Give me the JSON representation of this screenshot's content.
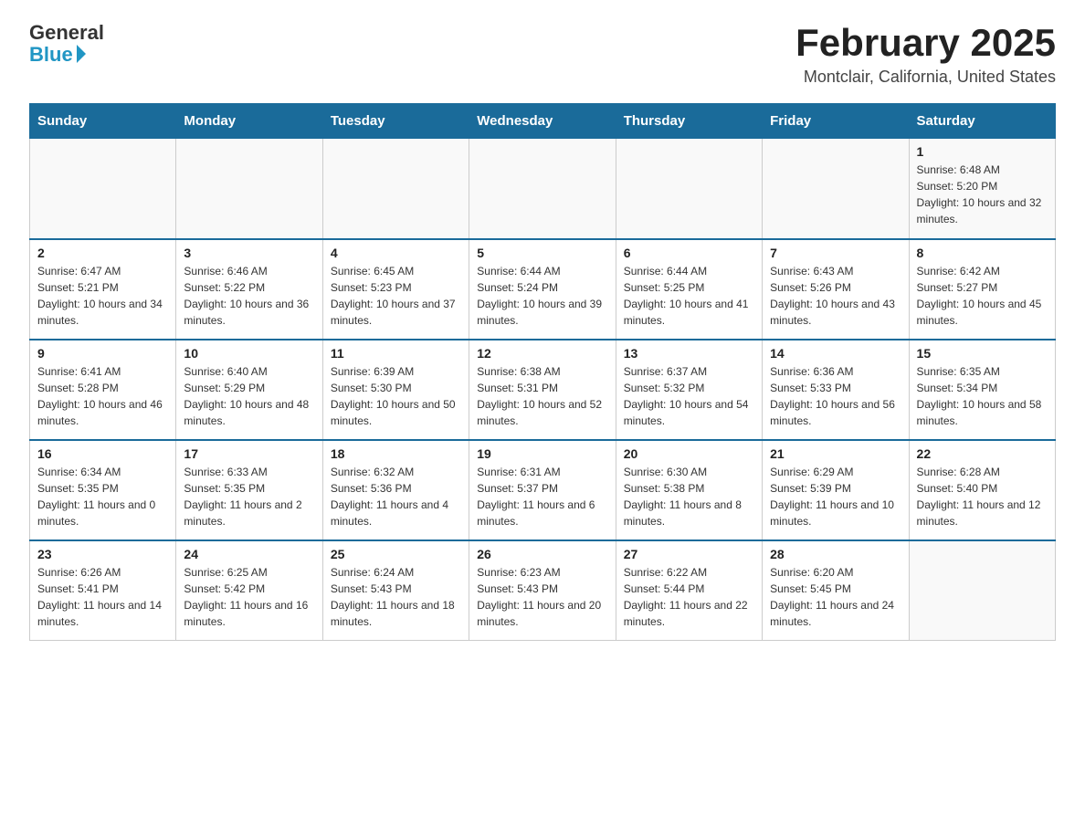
{
  "logo": {
    "general": "General",
    "blue": "Blue"
  },
  "header": {
    "title": "February 2025",
    "subtitle": "Montclair, California, United States"
  },
  "weekdays": [
    "Sunday",
    "Monday",
    "Tuesday",
    "Wednesday",
    "Thursday",
    "Friday",
    "Saturday"
  ],
  "weeks": [
    [
      {
        "day": "",
        "sunrise": "",
        "sunset": "",
        "daylight": ""
      },
      {
        "day": "",
        "sunrise": "",
        "sunset": "",
        "daylight": ""
      },
      {
        "day": "",
        "sunrise": "",
        "sunset": "",
        "daylight": ""
      },
      {
        "day": "",
        "sunrise": "",
        "sunset": "",
        "daylight": ""
      },
      {
        "day": "",
        "sunrise": "",
        "sunset": "",
        "daylight": ""
      },
      {
        "day": "",
        "sunrise": "",
        "sunset": "",
        "daylight": ""
      },
      {
        "day": "1",
        "sunrise": "Sunrise: 6:48 AM",
        "sunset": "Sunset: 5:20 PM",
        "daylight": "Daylight: 10 hours and 32 minutes."
      }
    ],
    [
      {
        "day": "2",
        "sunrise": "Sunrise: 6:47 AM",
        "sunset": "Sunset: 5:21 PM",
        "daylight": "Daylight: 10 hours and 34 minutes."
      },
      {
        "day": "3",
        "sunrise": "Sunrise: 6:46 AM",
        "sunset": "Sunset: 5:22 PM",
        "daylight": "Daylight: 10 hours and 36 minutes."
      },
      {
        "day": "4",
        "sunrise": "Sunrise: 6:45 AM",
        "sunset": "Sunset: 5:23 PM",
        "daylight": "Daylight: 10 hours and 37 minutes."
      },
      {
        "day": "5",
        "sunrise": "Sunrise: 6:44 AM",
        "sunset": "Sunset: 5:24 PM",
        "daylight": "Daylight: 10 hours and 39 minutes."
      },
      {
        "day": "6",
        "sunrise": "Sunrise: 6:44 AM",
        "sunset": "Sunset: 5:25 PM",
        "daylight": "Daylight: 10 hours and 41 minutes."
      },
      {
        "day": "7",
        "sunrise": "Sunrise: 6:43 AM",
        "sunset": "Sunset: 5:26 PM",
        "daylight": "Daylight: 10 hours and 43 minutes."
      },
      {
        "day": "8",
        "sunrise": "Sunrise: 6:42 AM",
        "sunset": "Sunset: 5:27 PM",
        "daylight": "Daylight: 10 hours and 45 minutes."
      }
    ],
    [
      {
        "day": "9",
        "sunrise": "Sunrise: 6:41 AM",
        "sunset": "Sunset: 5:28 PM",
        "daylight": "Daylight: 10 hours and 46 minutes."
      },
      {
        "day": "10",
        "sunrise": "Sunrise: 6:40 AM",
        "sunset": "Sunset: 5:29 PM",
        "daylight": "Daylight: 10 hours and 48 minutes."
      },
      {
        "day": "11",
        "sunrise": "Sunrise: 6:39 AM",
        "sunset": "Sunset: 5:30 PM",
        "daylight": "Daylight: 10 hours and 50 minutes."
      },
      {
        "day": "12",
        "sunrise": "Sunrise: 6:38 AM",
        "sunset": "Sunset: 5:31 PM",
        "daylight": "Daylight: 10 hours and 52 minutes."
      },
      {
        "day": "13",
        "sunrise": "Sunrise: 6:37 AM",
        "sunset": "Sunset: 5:32 PM",
        "daylight": "Daylight: 10 hours and 54 minutes."
      },
      {
        "day": "14",
        "sunrise": "Sunrise: 6:36 AM",
        "sunset": "Sunset: 5:33 PM",
        "daylight": "Daylight: 10 hours and 56 minutes."
      },
      {
        "day": "15",
        "sunrise": "Sunrise: 6:35 AM",
        "sunset": "Sunset: 5:34 PM",
        "daylight": "Daylight: 10 hours and 58 minutes."
      }
    ],
    [
      {
        "day": "16",
        "sunrise": "Sunrise: 6:34 AM",
        "sunset": "Sunset: 5:35 PM",
        "daylight": "Daylight: 11 hours and 0 minutes."
      },
      {
        "day": "17",
        "sunrise": "Sunrise: 6:33 AM",
        "sunset": "Sunset: 5:35 PM",
        "daylight": "Daylight: 11 hours and 2 minutes."
      },
      {
        "day": "18",
        "sunrise": "Sunrise: 6:32 AM",
        "sunset": "Sunset: 5:36 PM",
        "daylight": "Daylight: 11 hours and 4 minutes."
      },
      {
        "day": "19",
        "sunrise": "Sunrise: 6:31 AM",
        "sunset": "Sunset: 5:37 PM",
        "daylight": "Daylight: 11 hours and 6 minutes."
      },
      {
        "day": "20",
        "sunrise": "Sunrise: 6:30 AM",
        "sunset": "Sunset: 5:38 PM",
        "daylight": "Daylight: 11 hours and 8 minutes."
      },
      {
        "day": "21",
        "sunrise": "Sunrise: 6:29 AM",
        "sunset": "Sunset: 5:39 PM",
        "daylight": "Daylight: 11 hours and 10 minutes."
      },
      {
        "day": "22",
        "sunrise": "Sunrise: 6:28 AM",
        "sunset": "Sunset: 5:40 PM",
        "daylight": "Daylight: 11 hours and 12 minutes."
      }
    ],
    [
      {
        "day": "23",
        "sunrise": "Sunrise: 6:26 AM",
        "sunset": "Sunset: 5:41 PM",
        "daylight": "Daylight: 11 hours and 14 minutes."
      },
      {
        "day": "24",
        "sunrise": "Sunrise: 6:25 AM",
        "sunset": "Sunset: 5:42 PM",
        "daylight": "Daylight: 11 hours and 16 minutes."
      },
      {
        "day": "25",
        "sunrise": "Sunrise: 6:24 AM",
        "sunset": "Sunset: 5:43 PM",
        "daylight": "Daylight: 11 hours and 18 minutes."
      },
      {
        "day": "26",
        "sunrise": "Sunrise: 6:23 AM",
        "sunset": "Sunset: 5:43 PM",
        "daylight": "Daylight: 11 hours and 20 minutes."
      },
      {
        "day": "27",
        "sunrise": "Sunrise: 6:22 AM",
        "sunset": "Sunset: 5:44 PM",
        "daylight": "Daylight: 11 hours and 22 minutes."
      },
      {
        "day": "28",
        "sunrise": "Sunrise: 6:20 AM",
        "sunset": "Sunset: 5:45 PM",
        "daylight": "Daylight: 11 hours and 24 minutes."
      },
      {
        "day": "",
        "sunrise": "",
        "sunset": "",
        "daylight": ""
      }
    ]
  ]
}
